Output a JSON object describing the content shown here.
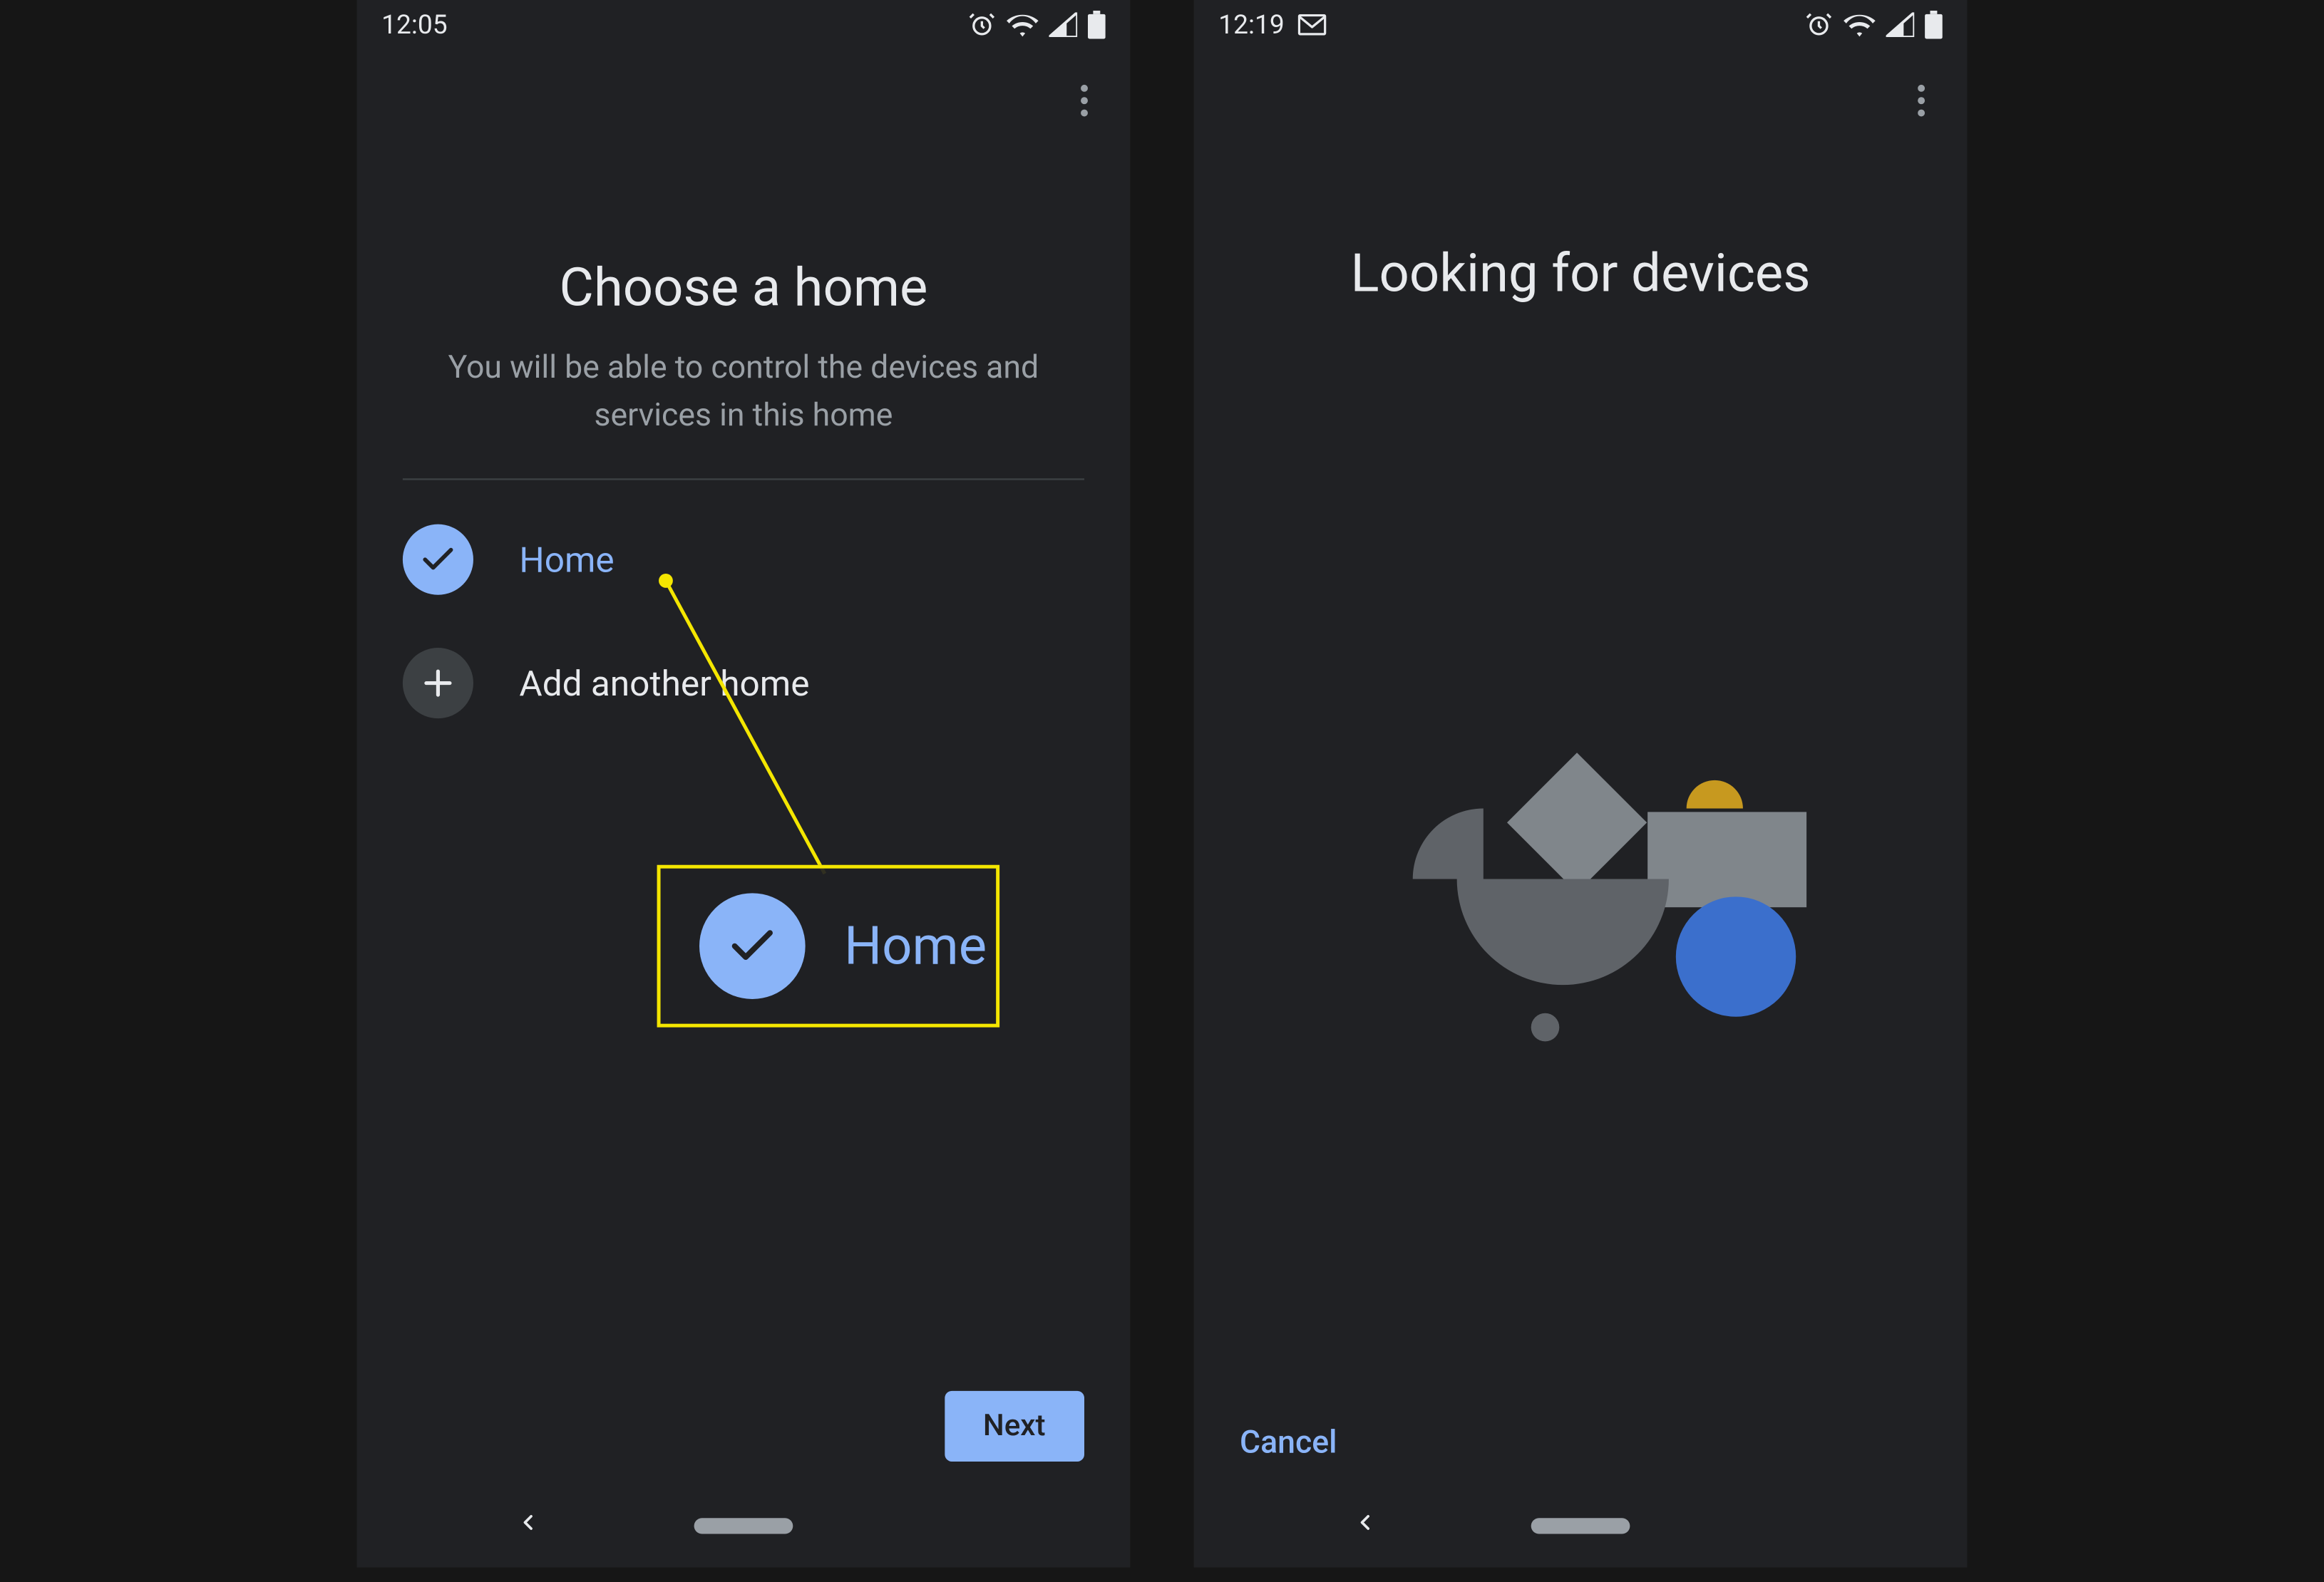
{
  "screen1": {
    "statusbar": {
      "time": "12:05"
    },
    "title": "Choose a home",
    "subtitle": "You will be able to control the devices and services in this home",
    "options": {
      "home_label": "Home",
      "add_label": "Add another home"
    },
    "next_button": "Next",
    "callout_label": "Home"
  },
  "screen2": {
    "statusbar": {
      "time": "12:19"
    },
    "title": "Looking for devices",
    "cancel_button": "Cancel"
  },
  "colors": {
    "accent_blue": "#8ab4f8",
    "highlight_yellow": "#f4e600",
    "illustration_blue": "#3b6fcc",
    "illustration_gold": "#c7991f"
  }
}
